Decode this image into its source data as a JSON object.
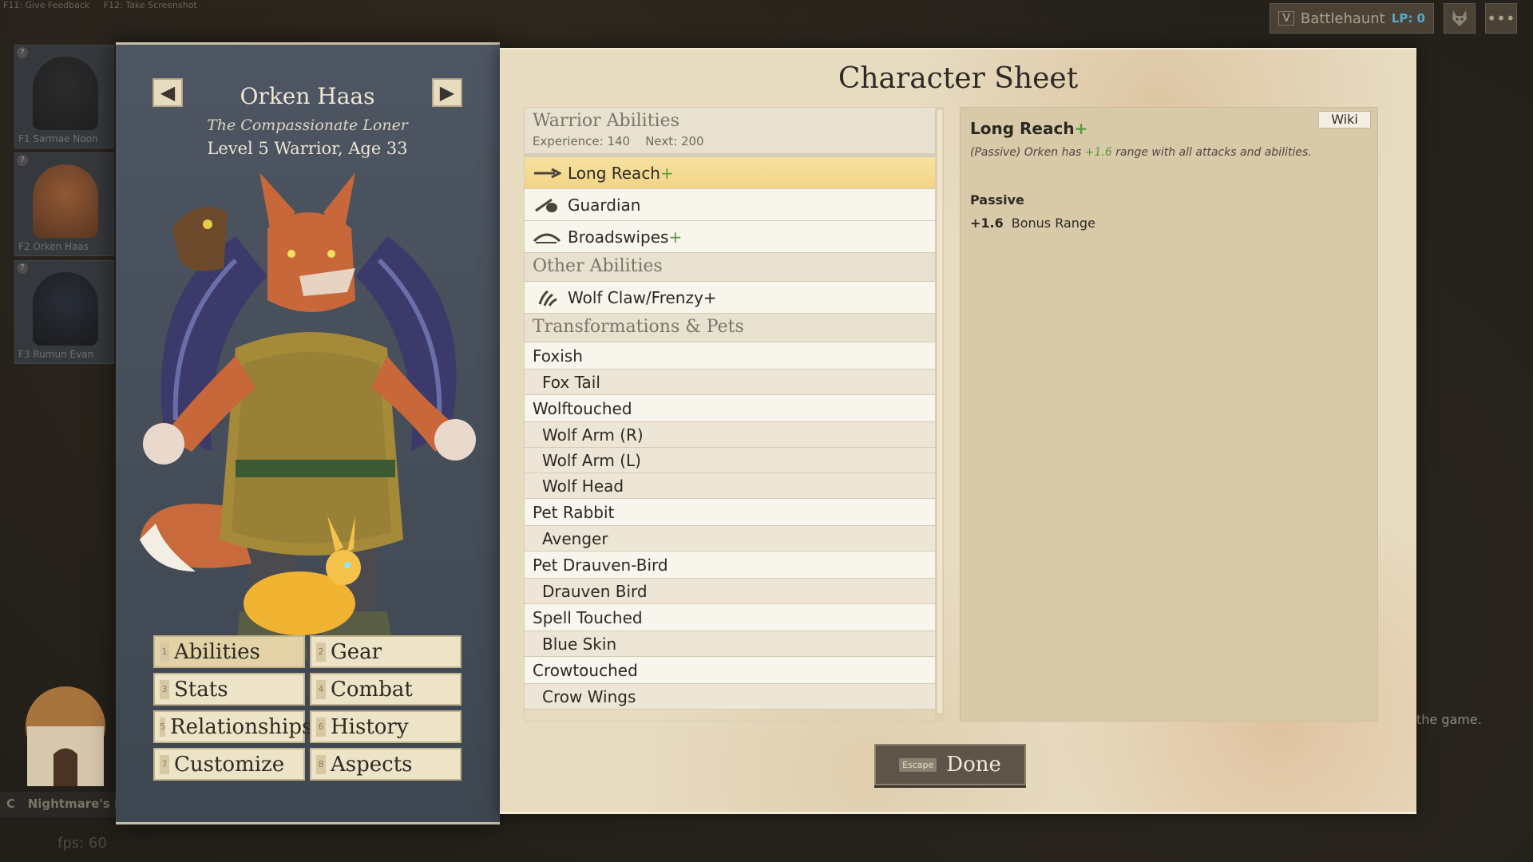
{
  "hints": [
    "F11: Give Feedback",
    "F12: Take Screenshot"
  ],
  "account": {
    "key": "V",
    "name": "Battlehaunt",
    "lp": "LP: 0"
  },
  "top_buttons": {
    "more": "•••"
  },
  "party": [
    {
      "label": "F1 Sarmae Noon",
      "badge": "?"
    },
    {
      "label": "F2 Orken Haas",
      "badge": "?"
    },
    {
      "label": "F3 Rumun Evan",
      "badge": "?"
    }
  ],
  "bottom_left": {
    "key": "C",
    "text": "Nightmare's E"
  },
  "fps": "fps: 60",
  "side_snippet": "the game.",
  "character": {
    "name": "Orken Haas",
    "title": "The Compassionate Loner",
    "level_line": "Level 5 Warrior, Age 33",
    "prev_arrow": "◀",
    "next_arrow": "▶"
  },
  "tabs": [
    {
      "num": "1",
      "label": "Abilities"
    },
    {
      "num": "2",
      "label": "Gear"
    },
    {
      "num": "3",
      "label": "Stats"
    },
    {
      "num": "4",
      "label": "Combat"
    },
    {
      "num": "5",
      "label": "Relationships"
    },
    {
      "num": "6",
      "label": "History"
    },
    {
      "num": "7",
      "label": "Customize"
    },
    {
      "num": "8",
      "label": "Aspects"
    }
  ],
  "sheet": {
    "title": "Character Sheet",
    "warrior": {
      "heading": "Warrior Abilities",
      "experience": "Experience: 140",
      "next": "Next: 200",
      "abilities": [
        {
          "name": "Long Reach",
          "plus": "+"
        },
        {
          "name": "Guardian",
          "plus": ""
        },
        {
          "name": "Broadswipes",
          "plus": "+"
        }
      ]
    },
    "other": {
      "heading": "Other Abilities",
      "abilities": [
        {
          "name": "Wolf Claw/Frenzy+"
        }
      ]
    },
    "transformations": {
      "heading": "Transformations & Pets",
      "items": [
        "Foxish",
        "Fox Tail",
        "Wolftouched",
        "Wolf Arm (R)",
        "Wolf Arm (L)",
        "Wolf Head",
        "Pet Rabbit",
        "Avenger",
        "Pet Drauven-Bird",
        "Drauven Bird",
        "Spell Touched",
        "Blue Skin",
        "Crowtouched",
        "Crow Wings"
      ]
    }
  },
  "detail": {
    "wiki": "Wiki",
    "name": "Long Reach",
    "plus": "+",
    "desc_pre": "(Passive) Orken has ",
    "desc_hl": "+1.6",
    "desc_post": " range with all attacks and abilities.",
    "section": "Passive",
    "stat_value": "+1.6",
    "stat_label": "Bonus Range"
  },
  "done": {
    "escape": "Escape",
    "label": "Done"
  },
  "colors": {
    "accent_green": "#5b9a3a",
    "selected_row": "#f3d486",
    "panel_blue": "#4d5662"
  }
}
